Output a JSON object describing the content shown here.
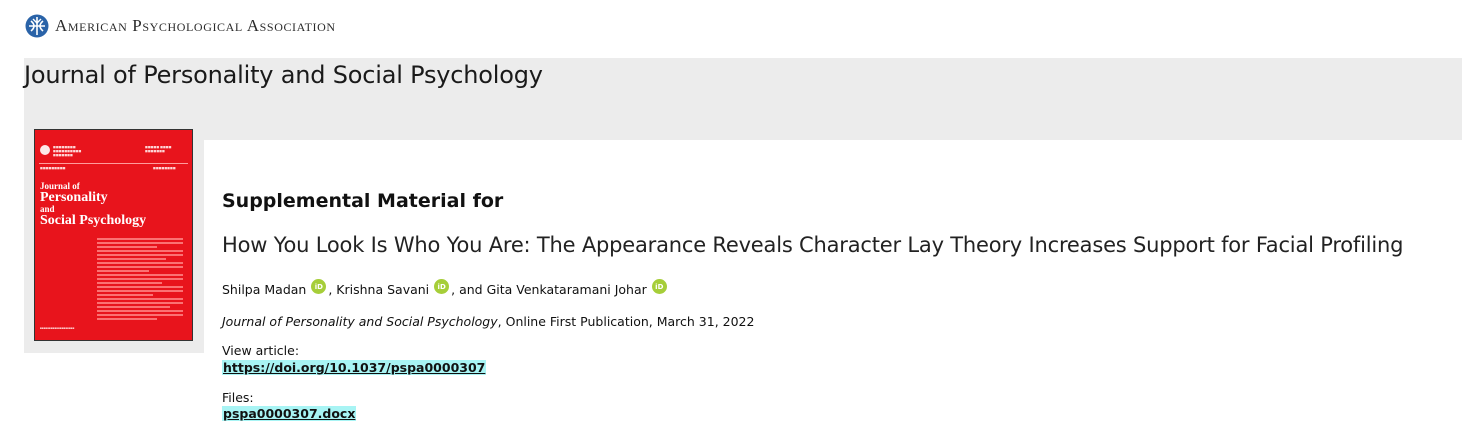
{
  "header": {
    "org_name": "American Psychological Association",
    "logo_icon": "apa-globe-icon"
  },
  "journal": {
    "title": "Journal of Personality and Social Psychology"
  },
  "cover": {
    "title_line1": "Journal of",
    "title_line2": "Personality",
    "title_line3": "and",
    "title_line4": "Social Psychology",
    "color": "#e8141c"
  },
  "article": {
    "heading": "Supplemental Material for",
    "title": "How You Look Is Who You Are: The Appearance Reveals Character Lay Theory Increases Support for Facial Profiling",
    "authors": [
      {
        "name": "Shilpa Madan",
        "sep": ", "
      },
      {
        "name": "Krishna Savani",
        "sep": ", and "
      },
      {
        "name": "Gita Venkataramani Johar",
        "sep": ""
      }
    ],
    "orcid_label": "iD",
    "citation_journal": "Journal of Personality and Social Psychology",
    "citation_rest": ", Online First Publication, March 31, 2022"
  },
  "view_article": {
    "label": "View article:",
    "link": "https://doi.org/10.1037/pspa0000307"
  },
  "files": {
    "label": "Files:",
    "link": "pspa0000307.docx"
  },
  "colors": {
    "link_highlight": "#a8f4f4",
    "orcid_green": "#a6ce39",
    "band_gray": "#ececec"
  }
}
